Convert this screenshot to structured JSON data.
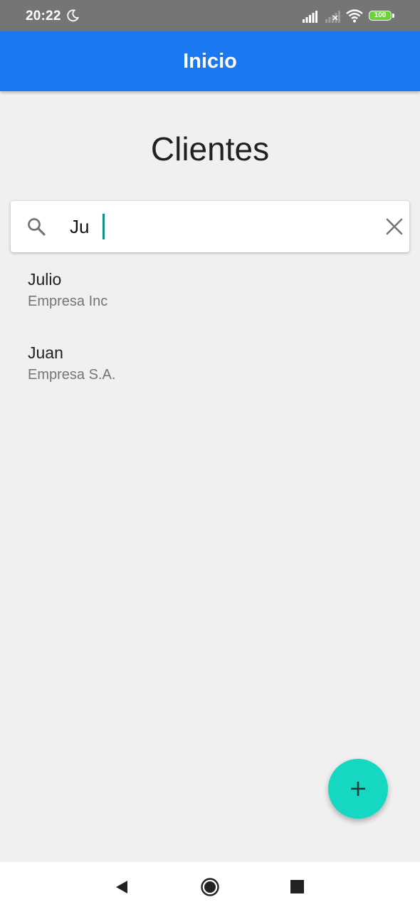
{
  "status_bar": {
    "time": "20:22",
    "battery": "100",
    "icons": [
      "moon-icon",
      "signal-icon",
      "signal-off-icon",
      "wifi-icon",
      "battery-icon"
    ]
  },
  "app_bar": {
    "title": "Inicio",
    "color": "#1a79f0"
  },
  "page": {
    "title": "Clientes"
  },
  "search": {
    "value": "Ju",
    "placeholder": "",
    "icons": [
      "search-icon",
      "close-icon"
    ]
  },
  "results": [
    {
      "name": "Julio",
      "company": "Empresa Inc"
    },
    {
      "name": "Juan",
      "company": "Empresa S.A."
    }
  ],
  "fab": {
    "icon": "add-icon",
    "color": "#16d8c2"
  },
  "nav_bar": {
    "icons": [
      "back-icon",
      "home-icon",
      "recents-icon"
    ]
  }
}
